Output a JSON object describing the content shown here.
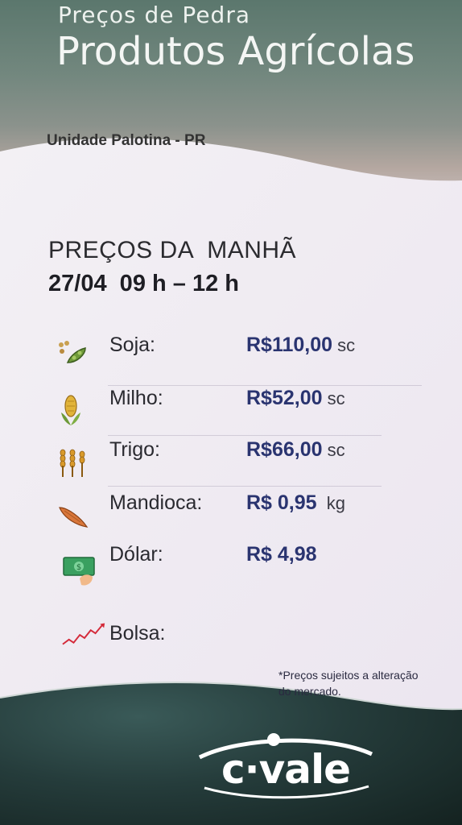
{
  "header": {
    "subtitle": "Preços de Pedra",
    "title": "Produtos Agrícolas",
    "unit": "Unidade Palotina - PR"
  },
  "session": {
    "title": "PREÇOS DA  MANHÃ",
    "datetime": "27/04  09 h – 12 h"
  },
  "prices": [
    {
      "label": "Soja:",
      "value": "R$110,00",
      "unit": " sc",
      "icon": "soybean-icon"
    },
    {
      "label": "Milho:",
      "value": "R$52,00",
      "unit": " sc",
      "icon": "corn-icon"
    },
    {
      "label": "Trigo:",
      "value": "R$66,00",
      "unit": " sc",
      "icon": "wheat-icon"
    },
    {
      "label": "Mandioca:",
      "value": "R$ 0,95",
      "unit": "  kg",
      "icon": "cassava-icon"
    },
    {
      "label": "Dólar:",
      "value": "R$ 4,98",
      "unit": "",
      "icon": "money-icon"
    },
    {
      "label": "Bolsa:",
      "value": "",
      "unit": "",
      "icon": "stock-chart-icon"
    }
  ],
  "footnote": "*Preços sujeitos a alteração do mercado.",
  "brand": {
    "logo_text": "c·vale",
    "accent": "#2a3470"
  }
}
